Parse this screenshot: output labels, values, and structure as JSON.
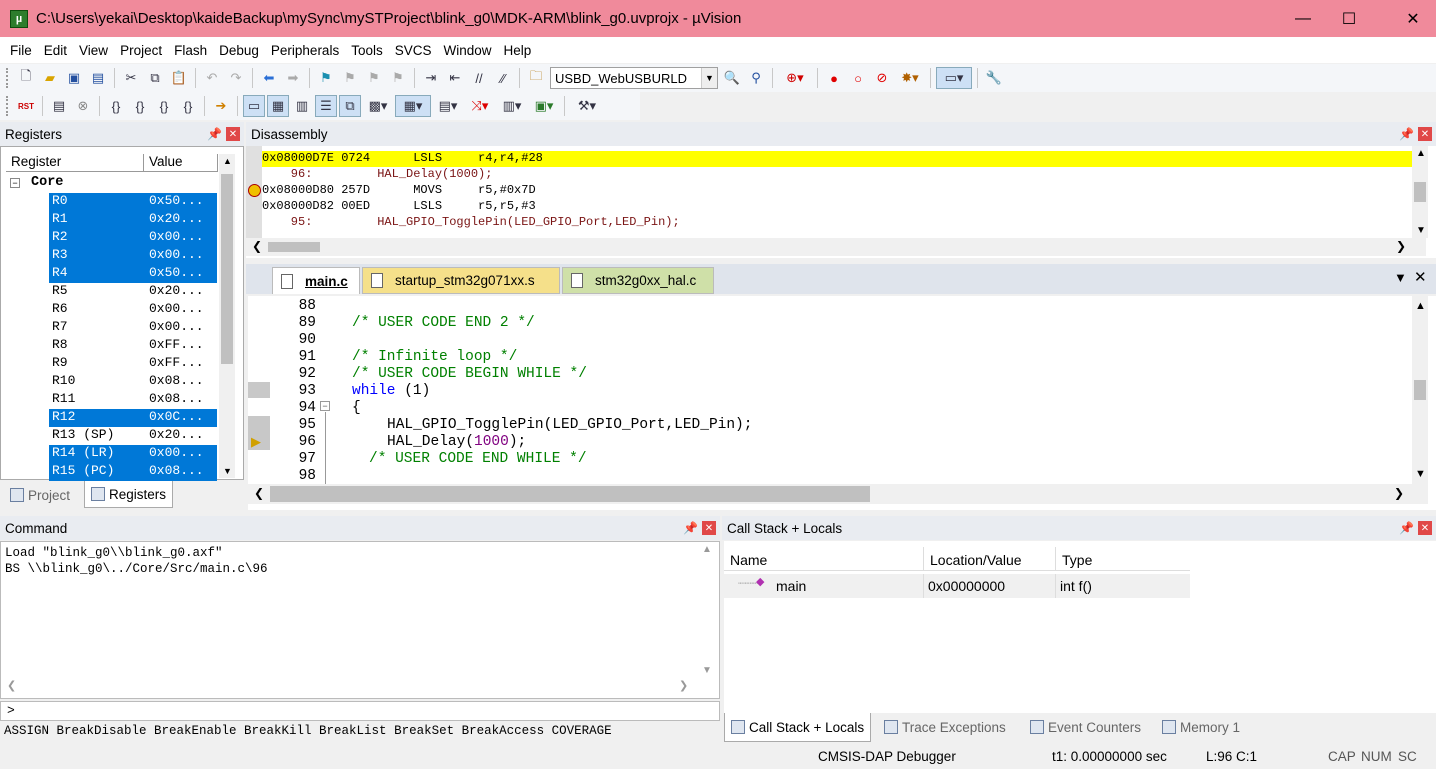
{
  "window": {
    "title": "C:\\Users\\yekai\\Desktop\\kaideBackup\\mySync\\mySTProject\\blink_g0\\MDK-ARM\\blink_g0.uvprojx - µVision",
    "minimize": "—",
    "maximize": "☐",
    "close": "✕"
  },
  "menu": [
    "File",
    "Edit",
    "View",
    "Project",
    "Flash",
    "Debug",
    "Peripherals",
    "Tools",
    "SVCS",
    "Window",
    "Help"
  ],
  "toolbar": {
    "target_combo": "USBD_WebUSBURLD",
    "rst_label": "RST"
  },
  "registers_panel": {
    "title": "Registers",
    "columns": [
      "Register",
      "Value"
    ],
    "group": "Core",
    "rows": [
      {
        "name": "R0",
        "value": "0x50...",
        "selected": true
      },
      {
        "name": "R1",
        "value": "0x20...",
        "selected": true
      },
      {
        "name": "R2",
        "value": "0x00...",
        "selected": true
      },
      {
        "name": "R3",
        "value": "0x00...",
        "selected": true
      },
      {
        "name": "R4",
        "value": "0x50...",
        "selected": true
      },
      {
        "name": "R5",
        "value": "0x20...",
        "selected": false
      },
      {
        "name": "R6",
        "value": "0x00...",
        "selected": false
      },
      {
        "name": "R7",
        "value": "0x00...",
        "selected": false
      },
      {
        "name": "R8",
        "value": "0xFF...",
        "selected": false
      },
      {
        "name": "R9",
        "value": "0xFF...",
        "selected": false
      },
      {
        "name": "R10",
        "value": "0x08...",
        "selected": false
      },
      {
        "name": "R11",
        "value": "0x08...",
        "selected": false
      },
      {
        "name": "R12",
        "value": "0x0C...",
        "selected": true
      },
      {
        "name": "R13 (SP)",
        "value": "0x20...",
        "selected": false
      },
      {
        "name": "R14 (LR)",
        "value": "0x00...",
        "selected": true
      },
      {
        "name": "R15 (PC)",
        "value": "0x08...",
        "selected": true
      }
    ],
    "tabs": [
      "Project",
      "Registers"
    ]
  },
  "disassembly": {
    "title": "Disassembly",
    "lines": [
      "0x08000D7E 0724      LSLS     r4,r4,#28",
      "    96:         HAL_Delay(1000);",
      "0x08000D80 257D      MOVS     r5,#0x7D",
      "0x08000D82 00ED      LSLS     r5,r5,#3",
      "    95:         HAL_GPIO_TogglePin(LED_GPIO_Port,LED_Pin);"
    ]
  },
  "editor": {
    "tabs": [
      "main.c",
      "startup_stm32g071xx.s",
      "stm32g0xx_hal.c"
    ],
    "line_numbers": [
      "88",
      "89",
      "90",
      "91",
      "92",
      "93",
      "94",
      "95",
      "96",
      "97",
      "98"
    ],
    "lines": {
      "l89": "/* USER CODE END 2 */",
      "l91": "/* Infinite loop */",
      "l92": "/* USER CODE BEGIN WHILE */",
      "l93_kw": "while",
      "l93_rest": " (1)",
      "l94": "{",
      "l95": "HAL_GPIO_TogglePin(LED_GPIO_Port,LED_Pin);",
      "l96_a": "HAL_Delay(",
      "l96_num": "1000",
      "l96_b": ");",
      "l97": "/* USER CODE END WHILE */"
    }
  },
  "command": {
    "title": "Command",
    "output": [
      "Load \"blink_g0\\\\blink_g0.axf\"",
      "BS \\\\blink_g0\\../Core/Src/main.c\\96"
    ],
    "prompt": ">",
    "hints": "ASSIGN BreakDisable BreakEnable BreakKill BreakList BreakSet BreakAccess COVERAGE"
  },
  "callstack": {
    "title": "Call Stack + Locals",
    "columns": [
      "Name",
      "Location/Value",
      "Type"
    ],
    "rows": [
      {
        "name": "main",
        "value": "0x00000000",
        "type": "int f()"
      }
    ],
    "tabs": [
      "Call Stack + Locals",
      "Trace Exceptions",
      "Event Counters",
      "Memory 1"
    ]
  },
  "status": {
    "debugger": "CMSIS-DAP Debugger",
    "time": "t1: 0.00000000 sec",
    "position": "L:96 C:1",
    "cap": "CAP",
    "num": "NUM",
    "scrl": "SC"
  },
  "colors": {
    "title_bar": "#f08a9b",
    "selection": "#0078d7",
    "current_line": "#ffff00",
    "comment": "#008000",
    "keyword": "#0000ff"
  }
}
